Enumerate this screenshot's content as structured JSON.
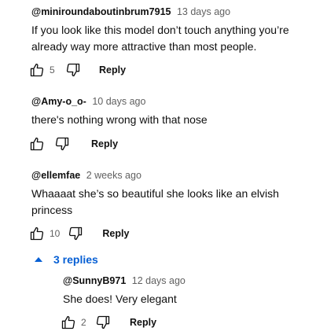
{
  "comments": [
    {
      "author": "@miniroundaboutinbrum7915",
      "time": "13 days ago",
      "text": "If you look like this model don’t touch anything you’re already way more attractive than most people.",
      "likes": "5",
      "reply_label": "Reply"
    },
    {
      "author": "@Amy-o_o-",
      "time": "10 days ago",
      "text": "there's nothing wrong with that nose",
      "likes": "",
      "reply_label": "Reply"
    },
    {
      "author": "@ellemfae",
      "time": "2 weeks ago",
      "text": "Whaaaat she’s so beautiful she looks like an elvish princess",
      "likes": "10",
      "reply_label": "Reply"
    }
  ],
  "replies_toggle": {
    "label": "3 replies"
  },
  "reply": {
    "author": "@SunnyB971",
    "time": "12 days ago",
    "text": "She does! Very elegant",
    "likes": "2",
    "reply_label": "Reply"
  },
  "colors": {
    "link_blue": "#065fd4",
    "meta_gray": "#606060",
    "text": "#0f0f0f"
  },
  "icons": [
    "thumbs-up-icon",
    "thumbs-down-icon",
    "caret-up-icon"
  ]
}
